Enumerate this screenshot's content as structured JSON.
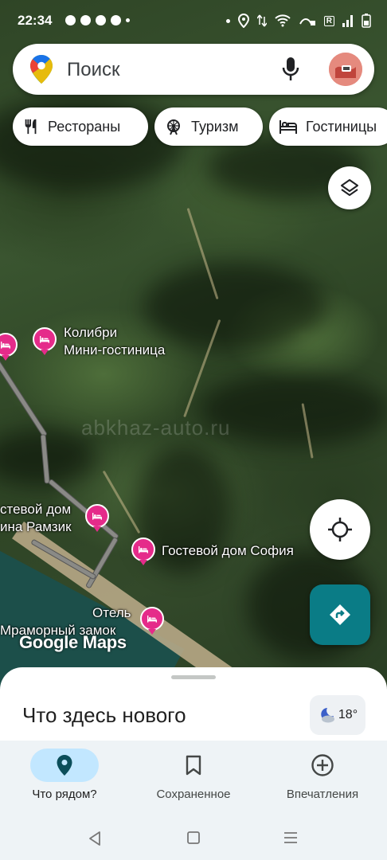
{
  "status_bar": {
    "time": "22:34",
    "network_label": "R"
  },
  "search": {
    "placeholder": "Поиск",
    "icons": [
      "google-maps-pin-icon",
      "microphone-icon",
      "avatar"
    ]
  },
  "chips": [
    {
      "label": "Рестораны",
      "icon": "fork-knife-icon"
    },
    {
      "label": "Туризм",
      "icon": "ferris-wheel-icon"
    },
    {
      "label": "Гостиницы",
      "icon": "bed-icon"
    }
  ],
  "map": {
    "watermark": "abkhaz-auto.ru",
    "logo": "Google Maps",
    "pois": [
      {
        "line1": "Колибри",
        "line2": "Мини-гостиница"
      },
      {
        "line1": "стевой дом",
        "line2": "ина Рамзик"
      },
      {
        "line1": "Гостевой дом София",
        "line2": ""
      },
      {
        "line1": "Отель",
        "line2": "Мраморный замок"
      }
    ]
  },
  "sheet": {
    "title": "Что здесь нового",
    "weather_temp": "18°"
  },
  "bottom_nav": [
    {
      "label": "Что рядом?",
      "icon": "location-pin-icon",
      "active": true
    },
    {
      "label": "Сохраненное",
      "icon": "bookmark-icon",
      "active": false
    },
    {
      "label": "Впечатления",
      "icon": "add-circle-icon",
      "active": false
    }
  ],
  "colors": {
    "poi": "#e52b8a",
    "directions": "#0a7c86",
    "nav_active": "#c2e7ff"
  }
}
